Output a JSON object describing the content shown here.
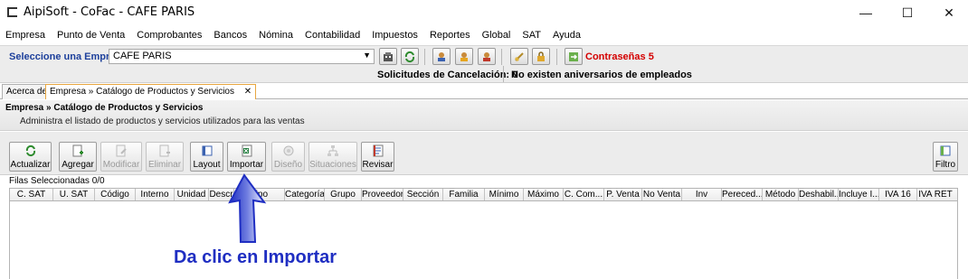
{
  "window": {
    "title": "AipiSoft - CoFac - CAFE PARIS",
    "minimize": "—",
    "maximize": "☐",
    "close": "✕"
  },
  "menu": [
    "Empresa",
    "Punto de Venta",
    "Comprobantes",
    "Bancos",
    "Nómina",
    "Contabilidad",
    "Impuestos",
    "Reportes",
    "Global",
    "SAT",
    "Ayuda"
  ],
  "company_bar": {
    "label": "Seleccione una Empresa",
    "selected": "CAFE PARIS",
    "passwords": "Contraseñas 5",
    "cancel_requests": "Solicitudes de Cancelación: 0",
    "anniversaries": "No existen aniversarios de empleados"
  },
  "tabs": [
    {
      "label": "Acerca de"
    },
    {
      "label": "Empresa » Catálogo de Productos y Servicios",
      "close": "✕"
    }
  ],
  "section": {
    "title": "Empresa » Catálogo de Productos y Servicios",
    "subtitle": "Administra el listado de productos y servicios utilizados para las ventas"
  },
  "actions": [
    {
      "label": "Actualizar",
      "enabled": true,
      "icon": "refresh-icon"
    },
    {
      "label": "Agregar",
      "enabled": true,
      "icon": "add-icon"
    },
    {
      "label": "Modificar",
      "enabled": false,
      "icon": "edit-icon"
    },
    {
      "label": "Eliminar",
      "enabled": false,
      "icon": "delete-icon"
    },
    {
      "label": "Layout",
      "enabled": true,
      "icon": "layout-icon"
    },
    {
      "label": "Importar",
      "enabled": true,
      "icon": "excel-icon"
    },
    {
      "label": "Diseño",
      "enabled": false,
      "icon": "design-icon"
    },
    {
      "label": "Situaciones",
      "enabled": false,
      "icon": "situations-icon"
    },
    {
      "label": "Revisar",
      "enabled": true,
      "icon": "review-icon"
    },
    {
      "label": "Filtro",
      "enabled": true,
      "icon": "filter-icon"
    }
  ],
  "grid": {
    "selected_rows": "Filas Seleccionadas  0/0",
    "columns": [
      "C. SAT",
      "U. SAT",
      "Código",
      "Interno",
      "Unidad",
      "Descr",
      "Tipo",
      "Categoría",
      "Grupo",
      "Proveedor",
      "Sección",
      "Familia",
      "Mínimo",
      "Máximo",
      "C. Com...",
      "P. Venta",
      "No Venta",
      "Inv",
      "Pereced...",
      "Método",
      "Deshabil...",
      "Incluye I...",
      "IVA 16",
      "IVA RET"
    ]
  },
  "annotation": {
    "text": "Da clic en Importar"
  },
  "colors": {
    "annotation": "#1f2ec2",
    "company_label": "#1c3f9b",
    "passwords": "#d40000",
    "active_tab_border": "#e8a640"
  }
}
